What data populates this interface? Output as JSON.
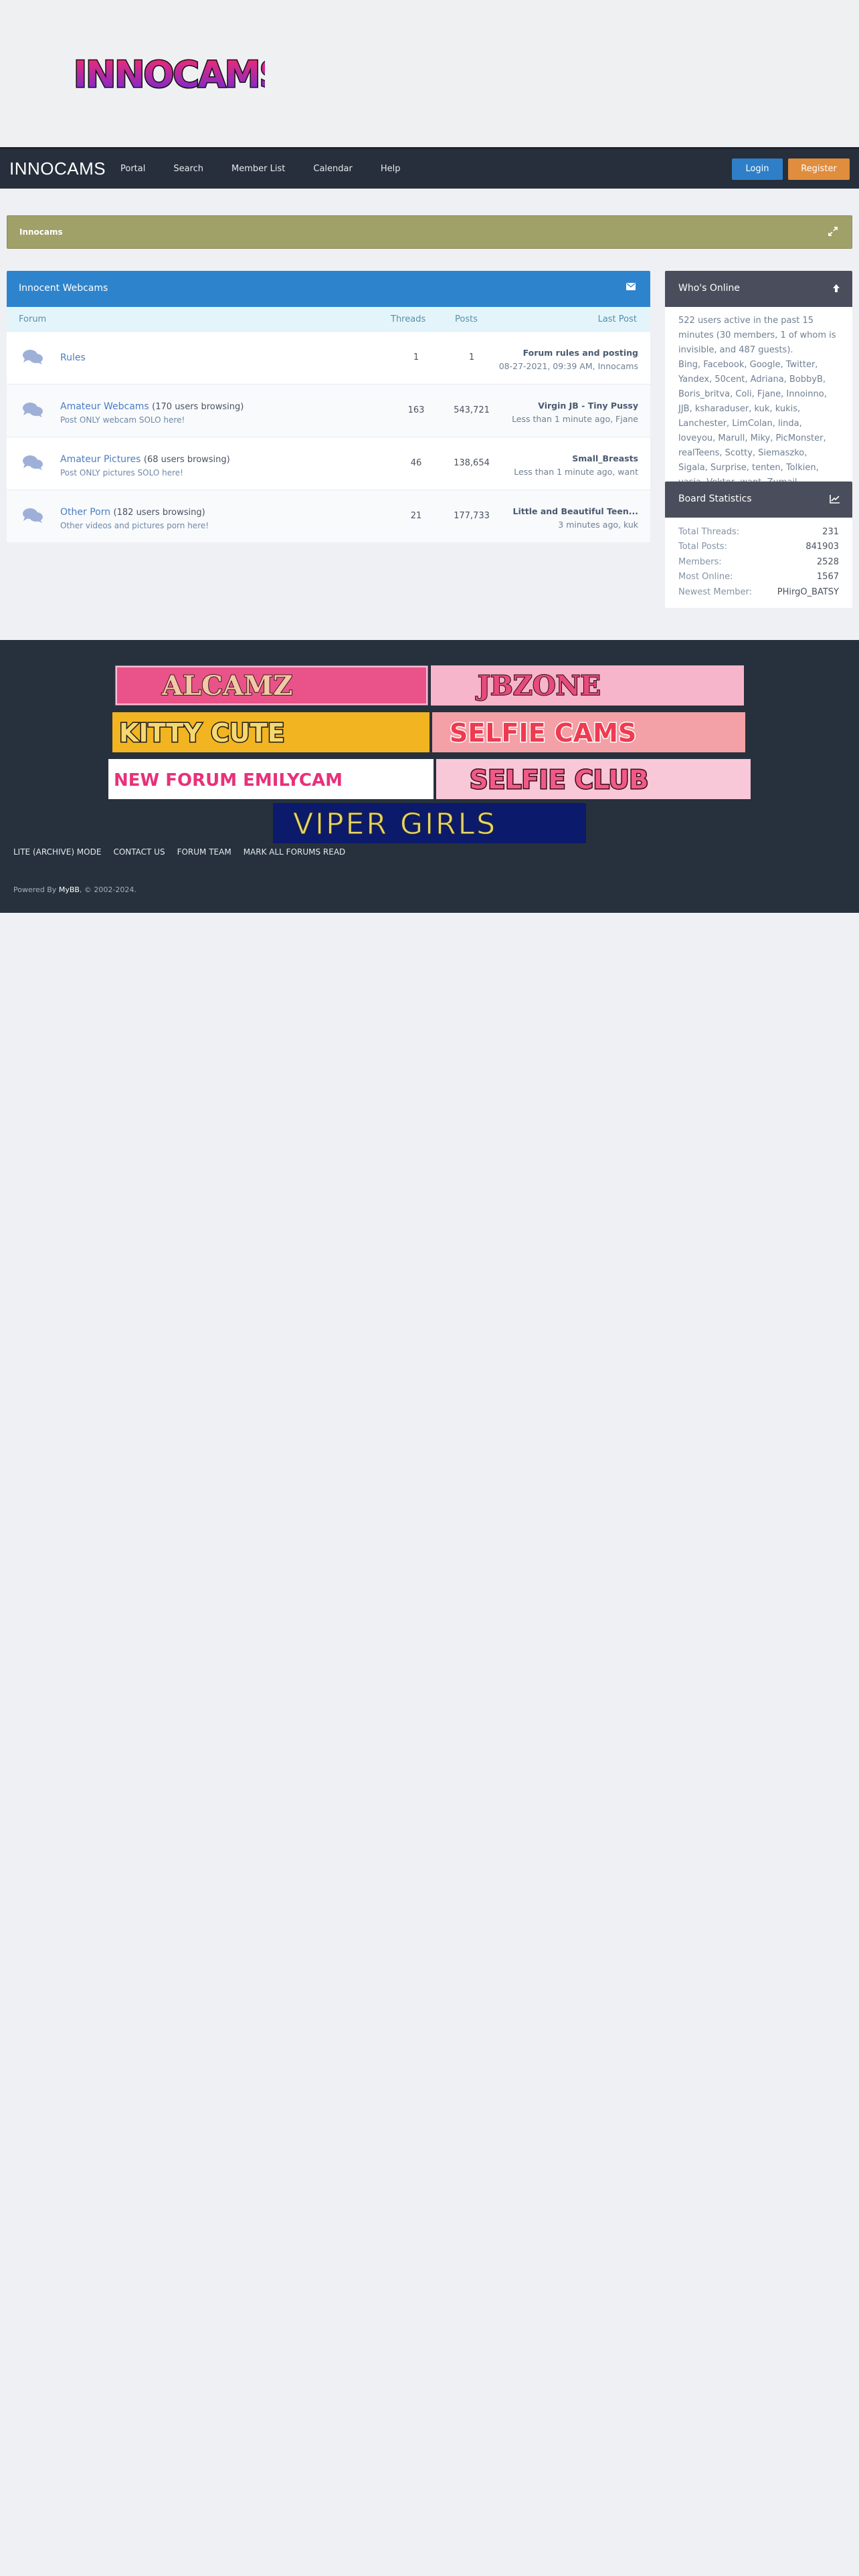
{
  "site_logo_text": "INNOCAMS",
  "navbar": {
    "brand": "INNOCAMS",
    "links": [
      "Portal",
      "Search",
      "Member List",
      "Calendar",
      "Help"
    ],
    "login": "Login",
    "register": "Register"
  },
  "announcement": {
    "title": "Innocams"
  },
  "forum": {
    "category_title": "Innocent Webcams",
    "columns": {
      "forum": "Forum",
      "threads": "Threads",
      "posts": "Posts",
      "last_post": "Last Post"
    },
    "rows": [
      {
        "name": "Rules",
        "browsing": "",
        "description": "",
        "threads": "1",
        "posts": "1",
        "last_title": "Forum rules and posting",
        "last_meta": "08-27-2021, 09:39 AM, Innocams"
      },
      {
        "name": "Amateur Webcams",
        "browsing": "(170 users browsing)",
        "description": "Post ONLY webcam SOLO here!",
        "threads": "163",
        "posts": "543,721",
        "last_title": "Virgin JB - Tiny Pussy",
        "last_meta": "Less than 1 minute ago, Fjane"
      },
      {
        "name": "Amateur Pictures",
        "browsing": "(68 users browsing)",
        "description": "Post ONLY pictures SOLO here!",
        "threads": "46",
        "posts": "138,654",
        "last_title": "Small_Breasts",
        "last_meta": "Less than 1 minute ago, want"
      },
      {
        "name": "Other Porn",
        "browsing": "(182 users browsing)",
        "description": "Other videos and pictures porn here!",
        "threads": "21",
        "posts": "177,733",
        "last_title": "Little and Beautiful Teen...",
        "last_meta": "3 minutes ago, kuk"
      }
    ]
  },
  "whos_online": {
    "title": "Who's Online",
    "summary": "522 users active in the past 15 minutes (30 members, 1 of whom is invisible, and 487 guests).",
    "members": "Bing, Facebook, Google, Twitter, Yandex, 50cent, Adriana, BobbyB, Boris_britva, Coli, Fjane, Innoinno, JJB, ksharaduser, kuk, kukis, Lanchester, LimColan, linda, loveyou, Marull, Miky, PicMonster, realTeens, Scotty, Siemaszko, Sigala, Surprise, tenten, Tolkien, vasia, Vektor, want, Zumajl"
  },
  "board_stats": {
    "title": "Board Statistics",
    "rows": [
      {
        "label": "Total Threads:",
        "value": "231"
      },
      {
        "label": "Total Posts:",
        "value": "841903"
      },
      {
        "label": "Members:",
        "value": "2528"
      },
      {
        "label": "Most Online:",
        "value": "1567"
      },
      {
        "label": "Newest Member:",
        "value": "PHirgO_BATSY"
      }
    ]
  },
  "banners": [
    "ALCAMZ",
    "JBZONE",
    "KITTY CUTE",
    "SELFIE CAMS",
    "NEW FORUM EMILYCAM",
    "SELFIE CLUB",
    "VIPER GIRLS"
  ],
  "footer": {
    "links": [
      "LITE (ARCHIVE) MODE",
      "CONTACT US",
      "FORUM TEAM",
      "MARK ALL FORUMS READ"
    ],
    "powered_prefix": "Powered By ",
    "powered_name": "MyBB",
    "powered_suffix": ", © 2002-2024."
  },
  "colors": {
    "accent": "#2e84cc",
    "navbar": "#262f3b",
    "announce": "#a0a069",
    "register": "#e08d3d",
    "footer": "#26313d"
  }
}
